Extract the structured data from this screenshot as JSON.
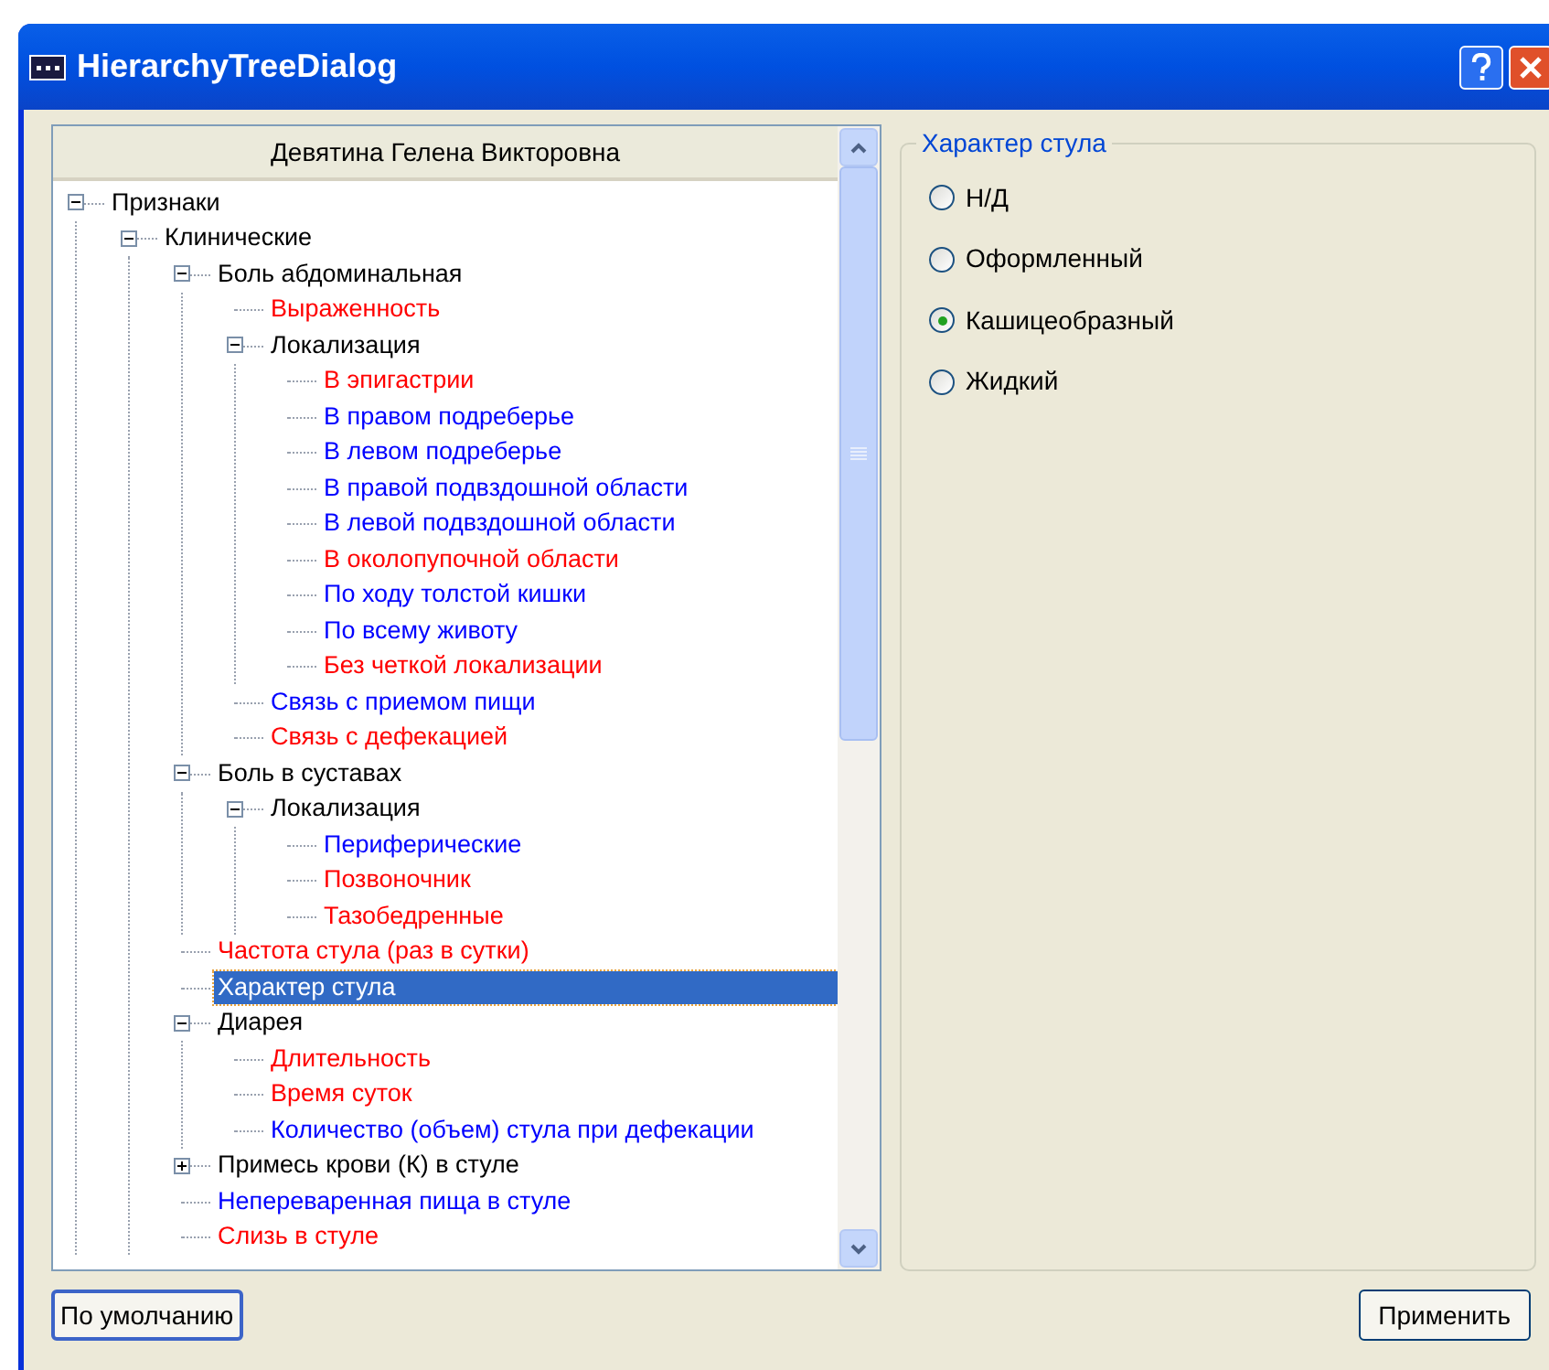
{
  "window": {
    "title": "HierarchyTreeDialog"
  },
  "tree": {
    "header": "Девятина Гелена Викторовна",
    "items": [
      {
        "label": "Признаки",
        "color": "#000000",
        "expanded": true,
        "selected": false,
        "children": [
          {
            "label": "Клинические",
            "color": "#000000",
            "expanded": true,
            "selected": false,
            "children": [
              {
                "label": "Боль абдоминальная",
                "color": "#000000",
                "expanded": true,
                "selected": false,
                "children": [
                  {
                    "label": "Выраженность",
                    "color": "#ff0000",
                    "selected": false
                  },
                  {
                    "label": "Локализация",
                    "color": "#000000",
                    "expanded": true,
                    "selected": false,
                    "children": [
                      {
                        "label": "В эпигастрии",
                        "color": "#ff0000",
                        "selected": false
                      },
                      {
                        "label": "В правом подреберье",
                        "color": "#0000ff",
                        "selected": false
                      },
                      {
                        "label": "В левом подреберье",
                        "color": "#0000ff",
                        "selected": false
                      },
                      {
                        "label": "В правой подвздошной области",
                        "color": "#0000ff",
                        "selected": false
                      },
                      {
                        "label": "В левой подвздошной области",
                        "color": "#0000ff",
                        "selected": false
                      },
                      {
                        "label": "В околопупочной области",
                        "color": "#ff0000",
                        "selected": false
                      },
                      {
                        "label": "По ходу толстой кишки",
                        "color": "#0000ff",
                        "selected": false
                      },
                      {
                        "label": "По всему животу",
                        "color": "#0000ff",
                        "selected": false
                      },
                      {
                        "label": "Без четкой локализации",
                        "color": "#ff0000",
                        "selected": false
                      }
                    ]
                  },
                  {
                    "label": "Связь с приемом пищи",
                    "color": "#0000ff",
                    "selected": false
                  },
                  {
                    "label": "Связь с дефекацией",
                    "color": "#ff0000",
                    "selected": false
                  }
                ]
              },
              {
                "label": "Боль в суставах",
                "color": "#000000",
                "expanded": true,
                "selected": false,
                "children": [
                  {
                    "label": "Локализация",
                    "color": "#000000",
                    "expanded": true,
                    "selected": false,
                    "children": [
                      {
                        "label": "Периферические",
                        "color": "#0000ff",
                        "selected": false
                      },
                      {
                        "label": "Позвоночник",
                        "color": "#ff0000",
                        "selected": false
                      },
                      {
                        "label": "Тазобедренные",
                        "color": "#ff0000",
                        "selected": false
                      }
                    ]
                  }
                ]
              },
              {
                "label": "Частота стула (раз в сутки)",
                "color": "#ff0000",
                "selected": false
              },
              {
                "label": "Характер стула",
                "selected": true
              },
              {
                "label": "Диарея",
                "color": "#000000",
                "expanded": true,
                "selected": false,
                "children": [
                  {
                    "label": "Длительность",
                    "color": "#ff0000",
                    "selected": false
                  },
                  {
                    "label": "Время суток",
                    "color": "#ff0000",
                    "selected": false
                  },
                  {
                    "label": "Количество (объем) стула при дефекации",
                    "color": "#0000ff",
                    "selected": false
                  }
                ]
              },
              {
                "label": "Примесь крови (К) в стуле",
                "color": "#000000",
                "expanded": false,
                "selected": false
              },
              {
                "label": "Непереваренная пища в стуле",
                "color": "#0000ff",
                "selected": false
              },
              {
                "label": "Слизь в стуле",
                "color": "#ff0000",
                "selected": false
              }
            ]
          }
        ]
      }
    ]
  },
  "group": {
    "title": "Характер стула",
    "options": [
      {
        "label": "Н/Д",
        "selected": false
      },
      {
        "label": "Оформленный",
        "selected": false
      },
      {
        "label": "Кашицеобразный",
        "selected": true
      },
      {
        "label": "Жидкий",
        "selected": false
      }
    ]
  },
  "buttons": {
    "default": "По умолчанию",
    "apply": "Применить"
  }
}
